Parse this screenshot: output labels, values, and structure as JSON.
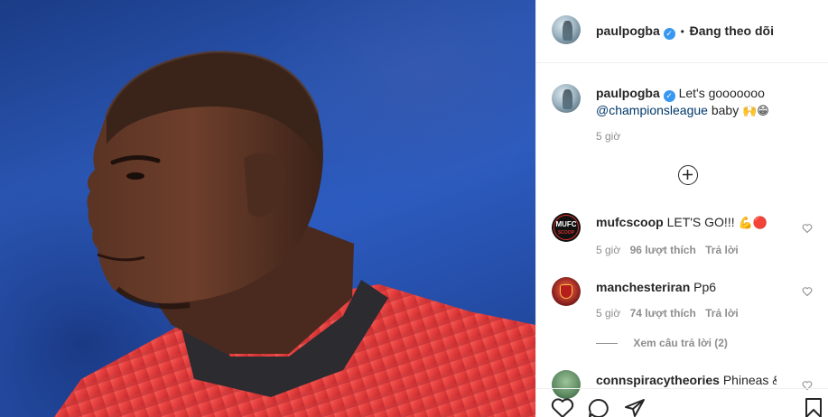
{
  "post": {
    "author": "paulpogba",
    "follow_status": "Đang theo dõi",
    "separator": "•",
    "caption": {
      "text": "Let's gooooooo",
      "mention": "@championsleague",
      "suffix": "baby",
      "emoji": "🙌😁"
    },
    "time": "5 giờ"
  },
  "load_more_icon": "plus-circle-icon",
  "comments": [
    {
      "username": "mufcscoop",
      "text": "LET'S GO!!!",
      "emoji": "💪🔴",
      "time": "5 giờ",
      "likes": "96 lượt thích",
      "reply": "Trả lời",
      "avatar_label": "MUFC",
      "avatar_sub": "SCOOP"
    },
    {
      "username": "manchesteriran",
      "text": "Pp6",
      "time": "5 giờ",
      "likes": "74 lượt thích",
      "reply": "Trả lời",
      "view_replies": "Xem câu trả lời (2)"
    },
    {
      "username": "connspiracytheories",
      "text": "Phineas &"
    }
  ],
  "actions": {
    "like_icon": "heart-icon",
    "comment_icon": "comment-icon",
    "share_icon": "share-icon",
    "save_icon": "bookmark-icon"
  },
  "colors": {
    "verified": "#3897f0",
    "mention": "#00376b",
    "meta": "#8e8e8e",
    "jersey": "#e8413f"
  }
}
